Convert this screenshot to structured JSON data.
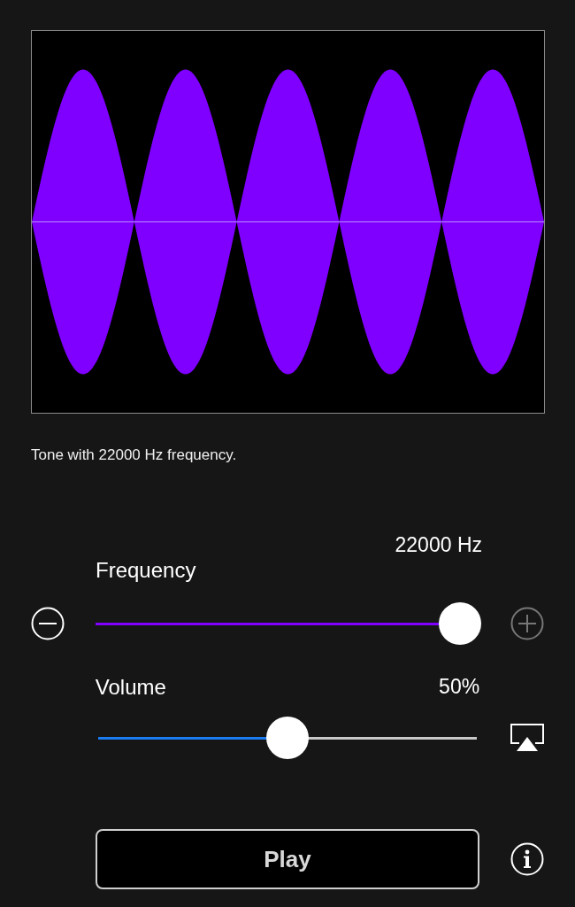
{
  "caption": "Tone with 22000 Hz frequency.",
  "frequency": {
    "label": "Frequency",
    "reading": "22000 Hz",
    "level": 1.0,
    "decrease_disabled": false,
    "increase_disabled": true
  },
  "volume": {
    "label": "Volume",
    "reading": "50%",
    "level": 0.5
  },
  "play_button": {
    "label": "Play"
  }
}
